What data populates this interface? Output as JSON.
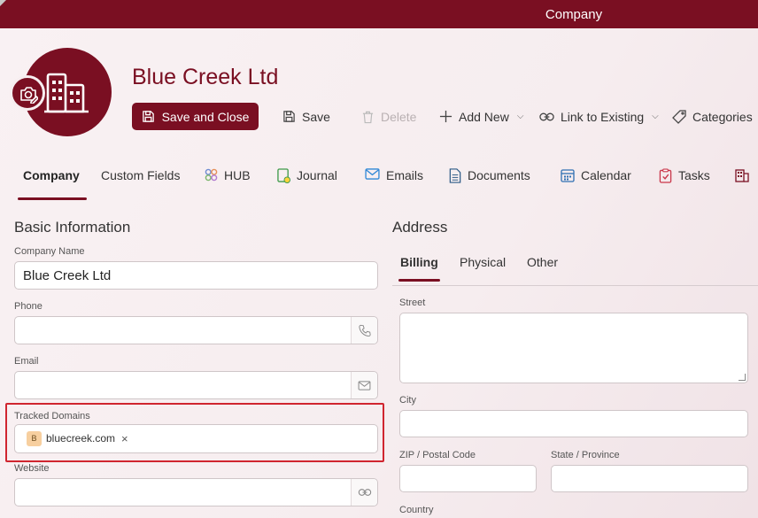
{
  "window": {
    "title": "Company"
  },
  "record": {
    "name": "Blue Creek Ltd"
  },
  "toolbar": {
    "save_close": "Save and Close",
    "save": "Save",
    "delete": "Delete",
    "add_new": "Add New",
    "link_existing": "Link to Existing",
    "categories": "Categories"
  },
  "tabs": [
    "Company",
    "Custom Fields",
    "HUB",
    "Journal",
    "Emails",
    "Documents",
    "Calendar",
    "Tasks"
  ],
  "basic": {
    "title": "Basic Information",
    "company_name_label": "Company Name",
    "company_name_value": "Blue Creek Ltd",
    "phone_label": "Phone",
    "email_label": "Email",
    "tracked_domains_label": "Tracked Domains",
    "domain_chip": {
      "initial": "B",
      "text": "bluecreek.com"
    },
    "website_label": "Website"
  },
  "address": {
    "title": "Address",
    "tabs": [
      "Billing",
      "Physical",
      "Other"
    ],
    "street_label": "Street",
    "city_label": "City",
    "zip_label": "ZIP / Postal Code",
    "state_label": "State / Province",
    "country_label": "Country"
  },
  "colors": {
    "accent": "#7a0f22",
    "highlight": "#d0252f"
  }
}
